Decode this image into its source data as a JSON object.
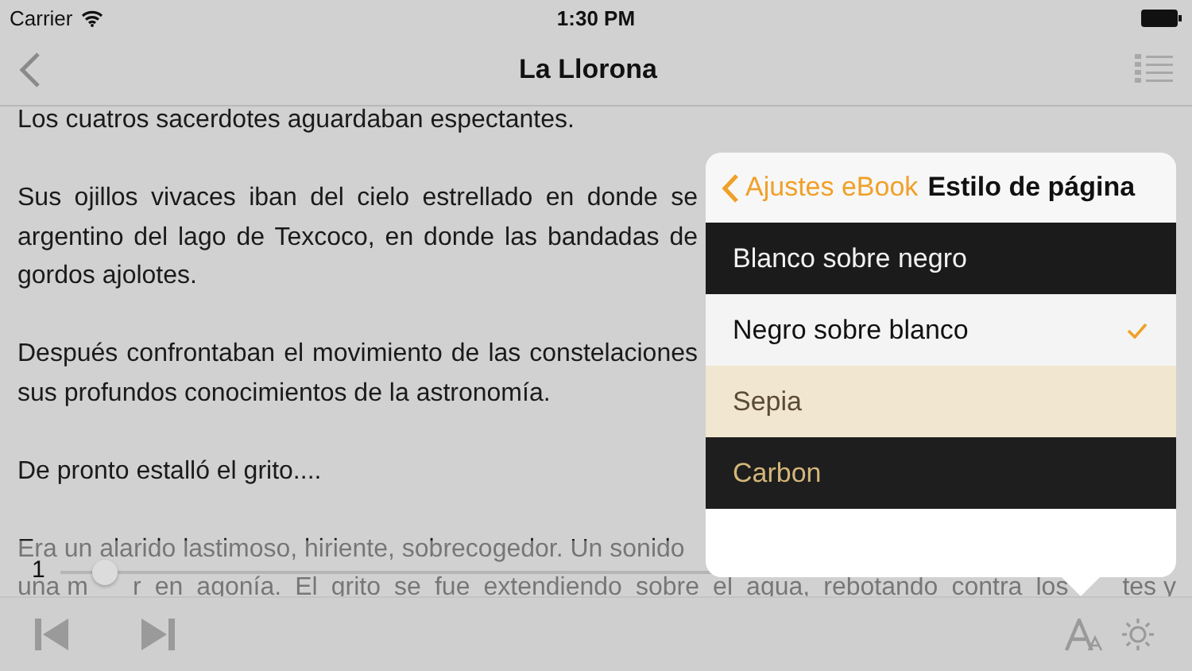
{
  "status_bar": {
    "carrier": "Carrier",
    "time": "1:30 PM"
  },
  "nav": {
    "title": "La Llorona"
  },
  "paragraphs": [
    {
      "lines": [
        "Los cuatros sacerdotes aguardaban espectantes."
      ]
    },
    {
      "lines": [
        "Sus ojillos vivaces iban del cielo estrellado en donde se",
        "argentino del lago de Texcoco, en donde las bandadas de",
        "gordos ajolotes."
      ]
    },
    {
      "lines": [
        "Después confrontaban el movimiento de las constelaciones",
        "sus profundos conocimientos de la astronomía."
      ]
    },
    {
      "lines": [
        "De pronto estalló el grito...."
      ]
    },
    {
      "lines": [
        "Era un alarido lastimoso, hiriente, sobrecogedor. Un sonido"
      ],
      "pieces": [
        "una m",
        "r en agonía. El grito se fue extendiendo sobre el agua, rebotando contra los",
        "tes y"
      ]
    }
  ],
  "page_slider": {
    "reading": "1",
    "level": 0.04
  },
  "popover": {
    "back": "Ajustes eBook",
    "title": "Estilo de página",
    "options": [
      {
        "label": "Blanco sobre negro",
        "kind": "dark",
        "selected": false
      },
      {
        "label": "Negro sobre blanco",
        "kind": "light",
        "selected": true
      },
      {
        "label": "Sepia",
        "kind": "sepia",
        "selected": false
      },
      {
        "label": "Carbon",
        "kind": "carbon",
        "selected": false
      }
    ]
  }
}
